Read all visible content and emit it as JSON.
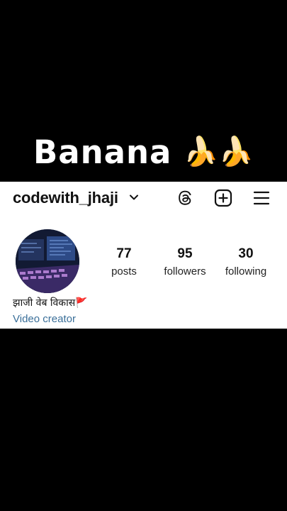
{
  "overlay": {
    "title": "Banana",
    "emojis": "🍌🍌"
  },
  "profile": {
    "username": "codewith_jhaji",
    "display_name": "झाजी  वेब विकास🚩",
    "category": "Video creator",
    "stats": [
      {
        "value": "77",
        "label": "posts"
      },
      {
        "value": "95",
        "label": "followers"
      },
      {
        "value": "30",
        "label": "following"
      }
    ]
  },
  "icons": {
    "threads": "threads-icon",
    "create": "plus-square-icon",
    "menu": "hamburger-menu-icon",
    "chevron": "chevron-down-icon"
  },
  "colors": {
    "background": "#000000",
    "panel": "#ffffff",
    "category_link": "#3a6f99"
  }
}
